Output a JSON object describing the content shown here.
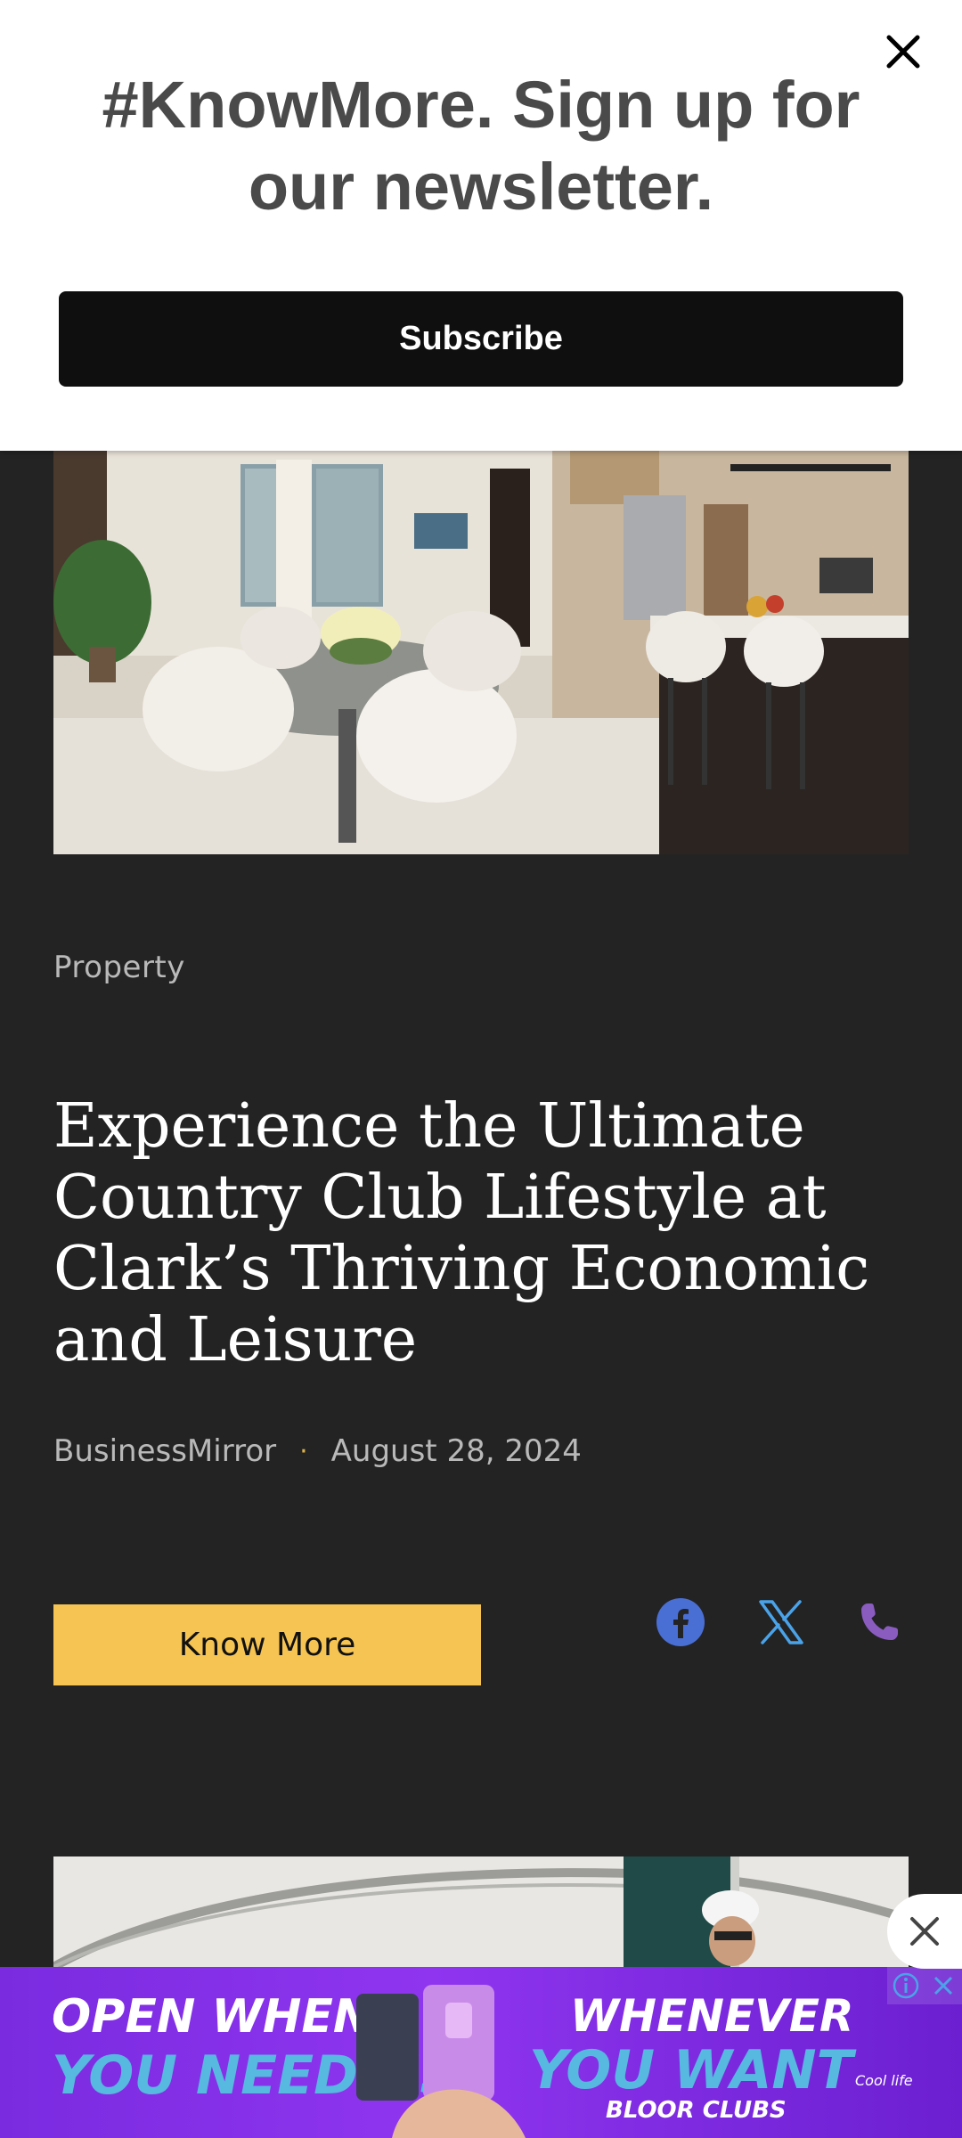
{
  "newsletter": {
    "heading": "#KnowMore. Sign up for our newsletter.",
    "subscribe_label": "Subscribe",
    "close_icon": "close-icon"
  },
  "article": {
    "category": "Property",
    "title": "Experience the Ultimate Country Club Lifestyle at Clark’s Thriving Economic and Leisure",
    "author": "BusinessMirror",
    "separator": "·",
    "date": "August 28, 2024",
    "know_more_label": "Know More",
    "share_icons": [
      "facebook-icon",
      "x-icon",
      "phone-icon"
    ]
  },
  "ad": {
    "left_line1": "OPEN WHEN",
    "left_line2": "YOU NEED US",
    "right_line1": "WHENEVER",
    "right_line2": "YOU WANT",
    "brand": "BLOOR CLUBS",
    "tag": "Cool life"
  },
  "colors": {
    "accent": "#f6c453",
    "facebook": "#4a6fd4",
    "twitter": "#4aa3e8",
    "phone": "#8a5cc0"
  }
}
